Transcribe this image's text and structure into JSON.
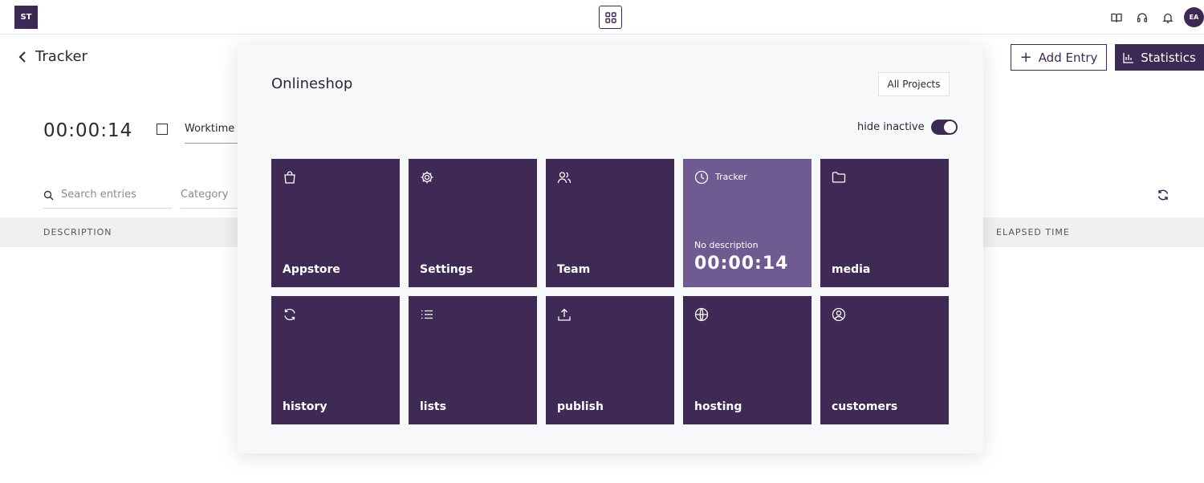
{
  "topbar": {
    "logo": "ST",
    "avatar": "EA",
    "icons": [
      "book-icon",
      "headset-icon",
      "bell-icon"
    ]
  },
  "header": {
    "title": "Tracker",
    "add_entry_label": "Add Entry",
    "statistics_label": "Statistics"
  },
  "timer": {
    "value": "00:00:14",
    "type_label": "Worktime"
  },
  "filters": {
    "search_placeholder": "Search entries",
    "category_label": "Category"
  },
  "table": {
    "columns": [
      "DESCRIPTION",
      "ELAPSED TIME"
    ]
  },
  "panel": {
    "title": "Onlineshop",
    "all_projects_label": "All Projects",
    "hide_inactive_label": "hide inactive",
    "hide_inactive_on": true,
    "tiles": [
      {
        "label": "Appstore",
        "icon": "shopping-bag-icon"
      },
      {
        "label": "Settings",
        "icon": "gear-icon"
      },
      {
        "label": "Team",
        "icon": "users-icon"
      },
      {
        "label": "Tracker",
        "icon": "clock-icon",
        "active": true,
        "description": "No description",
        "time": "00:00:14"
      },
      {
        "label": "media",
        "icon": "folder-icon"
      },
      {
        "label": "history",
        "icon": "refresh-icon"
      },
      {
        "label": "lists",
        "icon": "list-icon"
      },
      {
        "label": "publish",
        "icon": "upload-icon"
      },
      {
        "label": "hosting",
        "icon": "globe-icon"
      },
      {
        "label": "customers",
        "icon": "user-circle-icon"
      }
    ]
  },
  "colors": {
    "brand": "#3e2a55",
    "active_tile": "#6f5a92"
  }
}
